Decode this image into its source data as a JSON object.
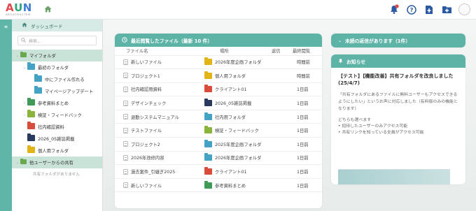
{
  "app": {
    "logo_text": "AUN",
    "logo_sub": "AROUCRUCTEM",
    "brand_colors": {
      "accent": "#5eb3a7",
      "alert": "#e2484c"
    }
  },
  "topbar": {
    "icons": [
      "home-icon",
      "bell-icon",
      "help-icon",
      "file-upload-icon",
      "folder-add-icon",
      "user-avatar-icon"
    ]
  },
  "sidebar": {
    "dashboard_label": "ダッシュボード",
    "search_placeholder": "検索...",
    "tree": [
      {
        "label": "マイフォルダ",
        "level": 0,
        "expanded": true,
        "color": "#6aa84f"
      },
      {
        "label": "最初のフォルダ",
        "level": 1,
        "expanded": true,
        "color": "#44a3c4"
      },
      {
        "label": "中にファイル作れる",
        "level": 2,
        "expanded": false,
        "color": "#44a3c4"
      },
      {
        "label": "マイページアップデート",
        "level": 2,
        "expanded": false,
        "color": "#44a3c4"
      },
      {
        "label": "参考資料まとめ",
        "level": 1,
        "expanded": false,
        "color": "#3e9a56"
      },
      {
        "label": "検証・フィードバック",
        "level": 1,
        "expanded": false,
        "color": "#8ab43c"
      },
      {
        "label": "社内確認資料",
        "level": 1,
        "expanded": false,
        "color": "#d94c3c"
      },
      {
        "label": "2026_05雑誌掲載",
        "level": 1,
        "expanded": false,
        "color": "#2a3a5e"
      },
      {
        "label": "個人用フォルダ",
        "level": 1,
        "expanded": false,
        "color": "#e2b418"
      }
    ],
    "shared_label": "他ユーザーからの共有",
    "shared_empty": "共有フォルダがありません"
  },
  "recent": {
    "title": "最近閲覧したファイル（最新 10 件）",
    "columns": [
      "ファイル名",
      "場所",
      "返信",
      "最終閲覧"
    ],
    "rows": [
      {
        "name": "新しいファイル",
        "location": "2026年度企画フォルダ",
        "loc_color": "#e2b418",
        "reply": "",
        "last_viewed": "時間前"
      },
      {
        "name": "プロジェクト1",
        "location": "個人用フォルダ",
        "loc_color": "#e2b418",
        "reply": "",
        "last_viewed": "時間前"
      },
      {
        "name": "社内確認用資料",
        "location": "クライアント01",
        "loc_color": "#d94c3c",
        "reply": "",
        "last_viewed": "1日前"
      },
      {
        "name": "デザインチェック",
        "location": "2026_05雑誌掲載",
        "loc_color": "#2a3a5e",
        "reply": "",
        "last_viewed": "1日前"
      },
      {
        "name": "退勤システムマニュアル",
        "location": "社内用フォルダ",
        "loc_color": "#44a3c4",
        "reply": "",
        "last_viewed": "1日前"
      },
      {
        "name": "テストファイル",
        "location": "検証・フィードバック",
        "loc_color": "#8ab43c",
        "reply": "",
        "last_viewed": "1日前"
      },
      {
        "name": "プロジェクト2",
        "location": "2025年度企画フォルダ",
        "loc_color": "#44a3c4",
        "reply": "",
        "last_viewed": "1日前"
      },
      {
        "name": "2026年改修内容",
        "location": "2026年度企画フォルダ",
        "loc_color": "#44a3c4",
        "reply": "",
        "last_viewed": "1日前"
      },
      {
        "name": "過去案件_引継ぎ2025",
        "location": "クライアント01",
        "loc_color": "#d94c3c",
        "reply": "",
        "last_viewed": "1日前"
      },
      {
        "name": "新しいファイル",
        "location": "参考資料まとめ",
        "loc_color": "#3e9a56",
        "reply": "",
        "last_viewed": "1日前"
      }
    ]
  },
  "unread": {
    "title": "未読の返信があります（1件）"
  },
  "news": {
    "title": "お知らせ",
    "headline": "【テスト】【機能改善】共有フォルダを改良しました(25/4/7)",
    "body": "「共有フォルダにあるファイルに無料ユーザーもアクセスできるようにしたい」というお声に対応しました（有料版のみの機能となります）",
    "list_intro": "どちらも選べます",
    "bullets": [
      "• 招待したユーザーのみアクセス可能",
      "• 共有リンクを知っている全員がアクセス可能"
    ]
  }
}
